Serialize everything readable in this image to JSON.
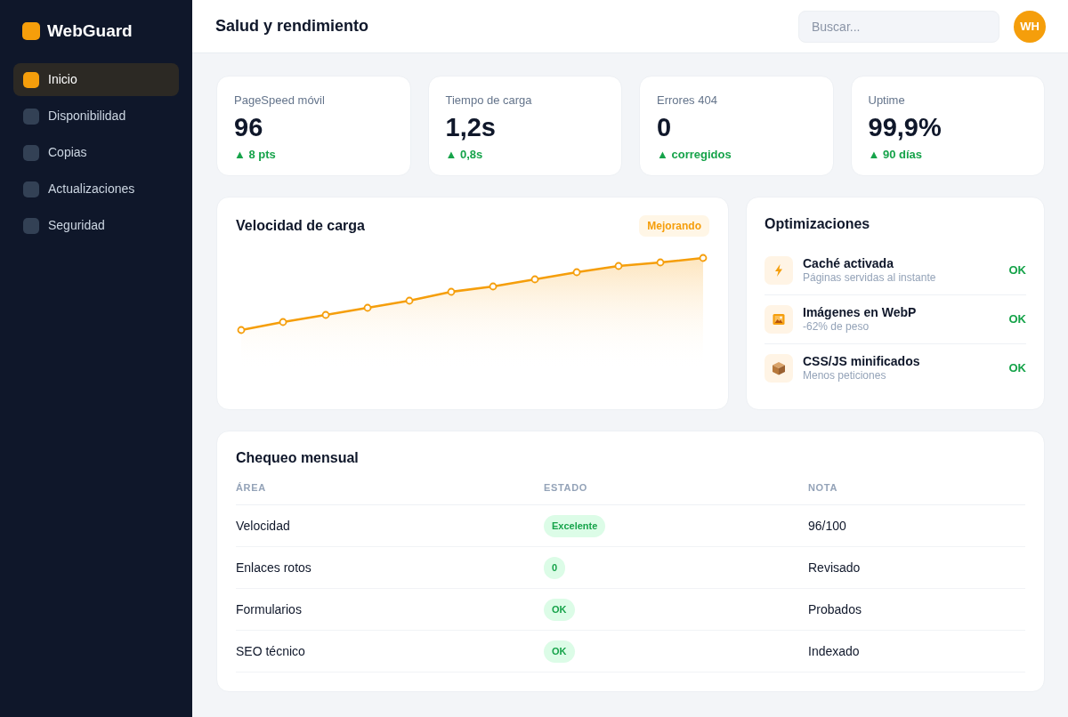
{
  "sidebar": {
    "logo": "WebGuard",
    "items": [
      {
        "label": "Inicio",
        "selected": true
      },
      {
        "label": "Disponibilidad",
        "selected": false
      },
      {
        "label": "Copias",
        "selected": false
      },
      {
        "label": "Actualizaciones",
        "selected": false
      },
      {
        "label": "Seguridad",
        "selected": false
      }
    ]
  },
  "header": {
    "title": "Salud y rendimiento",
    "search": {
      "placeholder": "Buscar..."
    },
    "avatar": "WH"
  },
  "stats": [
    {
      "label": "PageSpeed móvil",
      "value": "96",
      "delta": "▲ 8 pts"
    },
    {
      "label": "Tiempo de carga",
      "value": "1,2s",
      "delta": "▲ 0,8s"
    },
    {
      "label": "Errores 404",
      "value": "0",
      "delta": "▲ corregidos"
    },
    {
      "label": "Uptime",
      "value": "99,9%",
      "delta": "▲ 90 días"
    }
  ],
  "speed_chart": {
    "title": "Velocidad de carga",
    "badge": "Mejorando"
  },
  "optimizations": {
    "title": "Optimizaciones",
    "items": [
      {
        "kind": "bolt",
        "title": "Caché activada",
        "subtitle": "Páginas servidas al instante",
        "status": "OK"
      },
      {
        "kind": "image",
        "title": "Imágenes en WebP",
        "subtitle": "-62% de peso",
        "status": "OK"
      },
      {
        "kind": "box",
        "title": "CSS/JS minificados",
        "subtitle": "Menos peticiones",
        "status": "OK"
      }
    ]
  },
  "monthly_check": {
    "title": "Chequeo mensual",
    "columns": [
      "ÁREA",
      "ESTADO",
      "NOTA"
    ],
    "rows": [
      {
        "area": "Velocidad",
        "status": "Excelente",
        "note": "96/100"
      },
      {
        "area": "Enlaces rotos",
        "status": "0",
        "note": "Revisado"
      },
      {
        "area": "Formularios",
        "status": "OK",
        "note": "Probados"
      },
      {
        "area": "SEO técnico",
        "status": "OK",
        "note": "Indexado"
      }
    ]
  }
}
